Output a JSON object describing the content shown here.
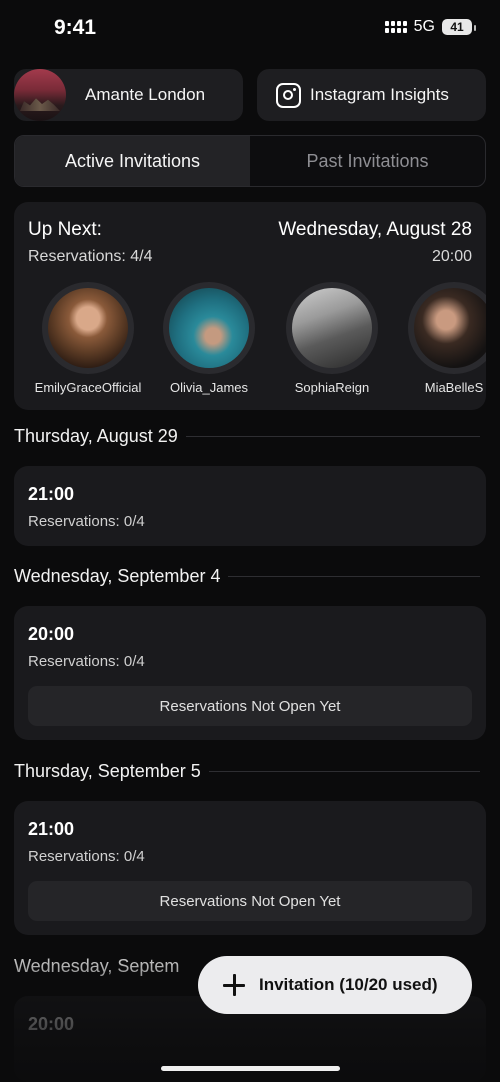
{
  "status_bar": {
    "time": "9:41",
    "network": "5G",
    "battery": "41"
  },
  "header": {
    "venue_name": "Amante London",
    "insights_label": "Instagram Insights"
  },
  "tabs": [
    {
      "label": "Active Invitations",
      "active": true
    },
    {
      "label": "Past Invitations",
      "active": false
    }
  ],
  "up_next": {
    "title": "Up Next:",
    "date": "Wednesday, August 28",
    "reservations": "Reservations: 4/4",
    "time": "20:00",
    "guests": [
      {
        "name": "EmilyGraceOfficial"
      },
      {
        "name": "Olivia_James"
      },
      {
        "name": "SophiaReign"
      },
      {
        "name": "MiaBelleS"
      }
    ]
  },
  "days": [
    {
      "date": "Thursday, August 29",
      "slot": {
        "time": "21:00",
        "reservations": "Reservations: 0/4"
      }
    },
    {
      "date": "Wednesday, September 4",
      "slot": {
        "time": "20:00",
        "reservations": "Reservations: 0/4",
        "status": "Reservations Not Open Yet"
      }
    },
    {
      "date": "Thursday, September 5",
      "slot": {
        "time": "21:00",
        "reservations": "Reservations: 0/4",
        "status": "Reservations Not Open Yet"
      }
    },
    {
      "date": "Wednesday, Septem",
      "slot": {
        "time": "20:00"
      }
    }
  ],
  "fab": {
    "label": "Invitation  (10/20 used)"
  },
  "colors": {
    "background": "#0b0b0c",
    "card": "#1a1a1d",
    "fab": "#ececee"
  }
}
